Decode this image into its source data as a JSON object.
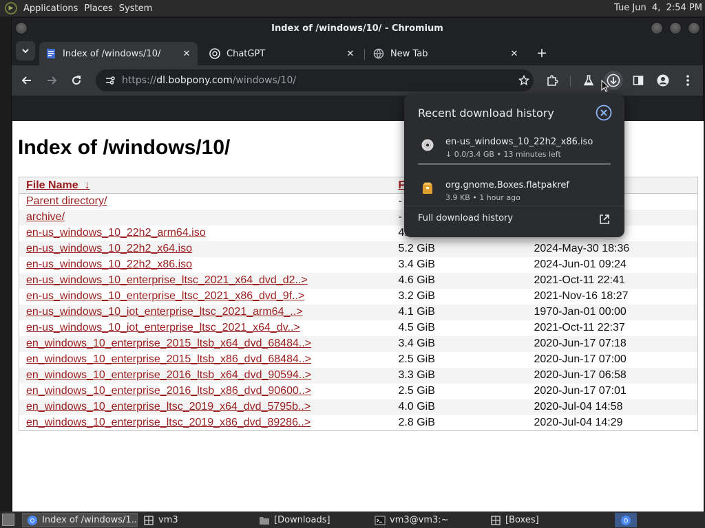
{
  "top_panel": {
    "menus": [
      "Applications",
      "Places",
      "System"
    ],
    "clock": "Tue Jun  4,  2:54 PM"
  },
  "window": {
    "title": "Index of /windows/10/ - Chromium"
  },
  "tabs": [
    {
      "title": "Index of /windows/10/",
      "icon": "page-icon",
      "active": true
    },
    {
      "title": "ChatGPT",
      "icon": "chatgpt-icon",
      "active": false
    },
    {
      "title": "New Tab",
      "icon": "globe-icon",
      "active": false
    }
  ],
  "toolbar": {
    "url_scheme": "https://",
    "url_host": "dl.bobpony.com",
    "url_path": "/windows/10/"
  },
  "page": {
    "heading": "Index of /windows/10/",
    "columns": {
      "name": "File Name",
      "sort_indicator": "↓",
      "size": "F",
      "date": ""
    },
    "rows": [
      {
        "name": "Parent directory/",
        "size": "-",
        "date": ""
      },
      {
        "name": "archive/",
        "size": "-",
        "date": ""
      },
      {
        "name": "en-us_windows_10_22h2_arm64.iso",
        "size": "4.",
        "date": ""
      },
      {
        "name": "en-us_windows_10_22h2_x64.iso",
        "size": "5.2 GiB",
        "date": "2024-May-30 18:36"
      },
      {
        "name": "en-us_windows_10_22h2_x86.iso",
        "size": "3.4 GiB",
        "date": "2024-Jun-01 09:24"
      },
      {
        "name": "en-us_windows_10_enterprise_ltsc_2021_x64_dvd_d2..>",
        "size": "4.6 GiB",
        "date": "2021-Oct-11 22:41"
      },
      {
        "name": "en-us_windows_10_enterprise_ltsc_2021_x86_dvd_9f..>",
        "size": "3.2 GiB",
        "date": "2021-Nov-16 18:27"
      },
      {
        "name": "en-us_windows_10_iot_enterprise_ltsc_2021_arm64_..>",
        "size": "4.1 GiB",
        "date": "1970-Jan-01 00:00"
      },
      {
        "name": "en-us_windows_10_iot_enterprise_ltsc_2021_x64_dv..>",
        "size": "4.5 GiB",
        "date": "2021-Oct-11 22:37"
      },
      {
        "name": "en_windows_10_enterprise_2015_ltsb_x64_dvd_68484..>",
        "size": "3.4 GiB",
        "date": "2020-Jun-17 07:18"
      },
      {
        "name": "en_windows_10_enterprise_2015_ltsb_x86_dvd_68484..>",
        "size": "2.5 GiB",
        "date": "2020-Jun-17 07:00"
      },
      {
        "name": "en_windows_10_enterprise_2016_ltsb_x64_dvd_90594..>",
        "size": "3.3 GiB",
        "date": "2020-Jun-17 06:58"
      },
      {
        "name": "en_windows_10_enterprise_2016_ltsb_x86_dvd_90600..>",
        "size": "2.5 GiB",
        "date": "2020-Jun-17 07:01"
      },
      {
        "name": "en_windows_10_enterprise_ltsc_2019_x64_dvd_5795b..>",
        "size": "4.0 GiB",
        "date": "2020-Jul-04 14:58"
      },
      {
        "name": "en_windows_10_enterprise_ltsc_2019_x86_dvd_89286..>",
        "size": "2.8 GiB",
        "date": "2020-Jul-04 14:29"
      }
    ]
  },
  "downloads": {
    "title": "Recent download history",
    "items": [
      {
        "name": "en-us_windows_10_22h2_x86.iso",
        "meta": "↓ 0.0/3.4 GB • 13 minutes left",
        "icon": "disc-icon",
        "progress": 0.0
      },
      {
        "name": "org.gnome.Boxes.flatpakref",
        "meta": "3.9 KB • 1 hour ago",
        "icon": "package-icon"
      }
    ],
    "full_history_label": "Full download history"
  },
  "taskbar": {
    "tasks": [
      {
        "label": "Index of /windows/1...",
        "icon": "chromium-icon",
        "active": true
      },
      {
        "label": "vm3",
        "icon": "boxes-icon",
        "active": false
      },
      {
        "label": "[Downloads]",
        "icon": "folder-icon",
        "active": false
      },
      {
        "label": "vm3@vm3:~",
        "icon": "terminal-icon",
        "active": false
      },
      {
        "label": "[Boxes]",
        "icon": "boxes-icon",
        "active": false
      }
    ]
  }
}
